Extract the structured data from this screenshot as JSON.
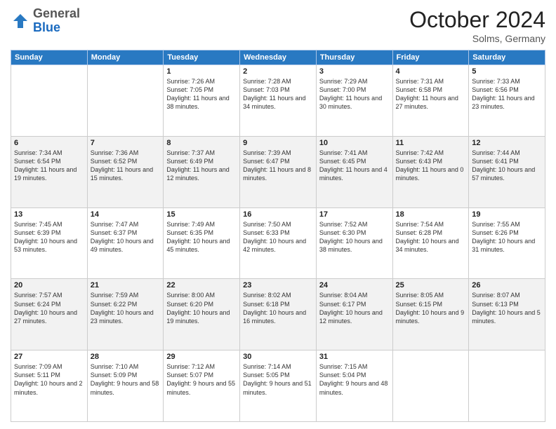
{
  "logo": {
    "general": "General",
    "blue": "Blue"
  },
  "header": {
    "month": "October 2024",
    "location": "Solms, Germany"
  },
  "weekdays": [
    "Sunday",
    "Monday",
    "Tuesday",
    "Wednesday",
    "Thursday",
    "Friday",
    "Saturday"
  ],
  "weeks": [
    [
      {
        "day": "",
        "sunrise": "",
        "sunset": "",
        "daylight": ""
      },
      {
        "day": "",
        "sunrise": "",
        "sunset": "",
        "daylight": ""
      },
      {
        "day": "1",
        "sunrise": "Sunrise: 7:26 AM",
        "sunset": "Sunset: 7:05 PM",
        "daylight": "Daylight: 11 hours and 38 minutes."
      },
      {
        "day": "2",
        "sunrise": "Sunrise: 7:28 AM",
        "sunset": "Sunset: 7:03 PM",
        "daylight": "Daylight: 11 hours and 34 minutes."
      },
      {
        "day": "3",
        "sunrise": "Sunrise: 7:29 AM",
        "sunset": "Sunset: 7:00 PM",
        "daylight": "Daylight: 11 hours and 30 minutes."
      },
      {
        "day": "4",
        "sunrise": "Sunrise: 7:31 AM",
        "sunset": "Sunset: 6:58 PM",
        "daylight": "Daylight: 11 hours and 27 minutes."
      },
      {
        "day": "5",
        "sunrise": "Sunrise: 7:33 AM",
        "sunset": "Sunset: 6:56 PM",
        "daylight": "Daylight: 11 hours and 23 minutes."
      }
    ],
    [
      {
        "day": "6",
        "sunrise": "Sunrise: 7:34 AM",
        "sunset": "Sunset: 6:54 PM",
        "daylight": "Daylight: 11 hours and 19 minutes."
      },
      {
        "day": "7",
        "sunrise": "Sunrise: 7:36 AM",
        "sunset": "Sunset: 6:52 PM",
        "daylight": "Daylight: 11 hours and 15 minutes."
      },
      {
        "day": "8",
        "sunrise": "Sunrise: 7:37 AM",
        "sunset": "Sunset: 6:49 PM",
        "daylight": "Daylight: 11 hours and 12 minutes."
      },
      {
        "day": "9",
        "sunrise": "Sunrise: 7:39 AM",
        "sunset": "Sunset: 6:47 PM",
        "daylight": "Daylight: 11 hours and 8 minutes."
      },
      {
        "day": "10",
        "sunrise": "Sunrise: 7:41 AM",
        "sunset": "Sunset: 6:45 PM",
        "daylight": "Daylight: 11 hours and 4 minutes."
      },
      {
        "day": "11",
        "sunrise": "Sunrise: 7:42 AM",
        "sunset": "Sunset: 6:43 PM",
        "daylight": "Daylight: 11 hours and 0 minutes."
      },
      {
        "day": "12",
        "sunrise": "Sunrise: 7:44 AM",
        "sunset": "Sunset: 6:41 PM",
        "daylight": "Daylight: 10 hours and 57 minutes."
      }
    ],
    [
      {
        "day": "13",
        "sunrise": "Sunrise: 7:45 AM",
        "sunset": "Sunset: 6:39 PM",
        "daylight": "Daylight: 10 hours and 53 minutes."
      },
      {
        "day": "14",
        "sunrise": "Sunrise: 7:47 AM",
        "sunset": "Sunset: 6:37 PM",
        "daylight": "Daylight: 10 hours and 49 minutes."
      },
      {
        "day": "15",
        "sunrise": "Sunrise: 7:49 AM",
        "sunset": "Sunset: 6:35 PM",
        "daylight": "Daylight: 10 hours and 45 minutes."
      },
      {
        "day": "16",
        "sunrise": "Sunrise: 7:50 AM",
        "sunset": "Sunset: 6:33 PM",
        "daylight": "Daylight: 10 hours and 42 minutes."
      },
      {
        "day": "17",
        "sunrise": "Sunrise: 7:52 AM",
        "sunset": "Sunset: 6:30 PM",
        "daylight": "Daylight: 10 hours and 38 minutes."
      },
      {
        "day": "18",
        "sunrise": "Sunrise: 7:54 AM",
        "sunset": "Sunset: 6:28 PM",
        "daylight": "Daylight: 10 hours and 34 minutes."
      },
      {
        "day": "19",
        "sunrise": "Sunrise: 7:55 AM",
        "sunset": "Sunset: 6:26 PM",
        "daylight": "Daylight: 10 hours and 31 minutes."
      }
    ],
    [
      {
        "day": "20",
        "sunrise": "Sunrise: 7:57 AM",
        "sunset": "Sunset: 6:24 PM",
        "daylight": "Daylight: 10 hours and 27 minutes."
      },
      {
        "day": "21",
        "sunrise": "Sunrise: 7:59 AM",
        "sunset": "Sunset: 6:22 PM",
        "daylight": "Daylight: 10 hours and 23 minutes."
      },
      {
        "day": "22",
        "sunrise": "Sunrise: 8:00 AM",
        "sunset": "Sunset: 6:20 PM",
        "daylight": "Daylight: 10 hours and 19 minutes."
      },
      {
        "day": "23",
        "sunrise": "Sunrise: 8:02 AM",
        "sunset": "Sunset: 6:18 PM",
        "daylight": "Daylight: 10 hours and 16 minutes."
      },
      {
        "day": "24",
        "sunrise": "Sunrise: 8:04 AM",
        "sunset": "Sunset: 6:17 PM",
        "daylight": "Daylight: 10 hours and 12 minutes."
      },
      {
        "day": "25",
        "sunrise": "Sunrise: 8:05 AM",
        "sunset": "Sunset: 6:15 PM",
        "daylight": "Daylight: 10 hours and 9 minutes."
      },
      {
        "day": "26",
        "sunrise": "Sunrise: 8:07 AM",
        "sunset": "Sunset: 6:13 PM",
        "daylight": "Daylight: 10 hours and 5 minutes."
      }
    ],
    [
      {
        "day": "27",
        "sunrise": "Sunrise: 7:09 AM",
        "sunset": "Sunset: 5:11 PM",
        "daylight": "Daylight: 10 hours and 2 minutes."
      },
      {
        "day": "28",
        "sunrise": "Sunrise: 7:10 AM",
        "sunset": "Sunset: 5:09 PM",
        "daylight": "Daylight: 9 hours and 58 minutes."
      },
      {
        "day": "29",
        "sunrise": "Sunrise: 7:12 AM",
        "sunset": "Sunset: 5:07 PM",
        "daylight": "Daylight: 9 hours and 55 minutes."
      },
      {
        "day": "30",
        "sunrise": "Sunrise: 7:14 AM",
        "sunset": "Sunset: 5:05 PM",
        "daylight": "Daylight: 9 hours and 51 minutes."
      },
      {
        "day": "31",
        "sunrise": "Sunrise: 7:15 AM",
        "sunset": "Sunset: 5:04 PM",
        "daylight": "Daylight: 9 hours and 48 minutes."
      },
      {
        "day": "",
        "sunrise": "",
        "sunset": "",
        "daylight": ""
      },
      {
        "day": "",
        "sunrise": "",
        "sunset": "",
        "daylight": ""
      }
    ]
  ]
}
